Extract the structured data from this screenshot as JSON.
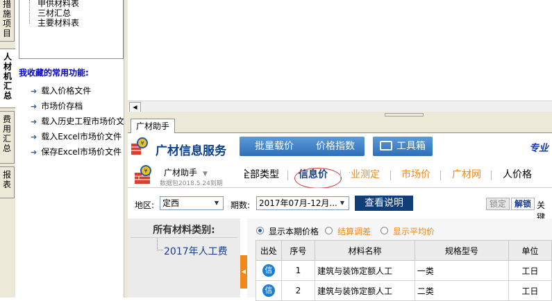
{
  "side_tabs": [
    "措施项目",
    "人材机汇总",
    "费用汇总",
    "报表"
  ],
  "tree": {
    "items": [
      "甲供材料表",
      "三材汇总",
      "主要材料表"
    ]
  },
  "favorites": {
    "title": "我收藏的常用功能:",
    "items": [
      "载入价格文件",
      "市场价存档",
      "载入历史工程市场价文",
      "载入Excel市场价文件",
      "保存Excel市场价文件"
    ]
  },
  "assistant_tab": "广材助手",
  "brand": {
    "title": "广材信息服务",
    "buttons": [
      "批量载价",
      "价格指数",
      "工具箱"
    ],
    "right_text": "专业"
  },
  "helper": {
    "title": "广材助手",
    "subtitle": "数据包2018.5.24到期"
  },
  "nav_tabs": [
    "全部类型",
    "信息价",
    "专业测定",
    "市场价",
    "广材网",
    "人价格"
  ],
  "filters": {
    "region_label": "地区:",
    "region_value": "定西",
    "period_label": "期数:",
    "period_value": "2017年07月-12月...",
    "help_button": "查看说明",
    "lock_button": "锁定",
    "unlock_button": "解锁",
    "right_text": "关键"
  },
  "categories": {
    "title": "所有材料类别:",
    "items": [
      "2017年人工费"
    ]
  },
  "options": {
    "selected": "显示本期价格",
    "items": [
      "显示本期价格",
      "结算调差",
      "显示平均价"
    ]
  },
  "table": {
    "headers": [
      "出处",
      "序号",
      "材料名称",
      "规格型号",
      "单位"
    ],
    "rows": [
      {
        "source": "信",
        "index": "1",
        "name": "建筑与装饰定额人工",
        "spec": "一类",
        "unit": "工日"
      },
      {
        "source": "信",
        "index": "2",
        "name": "建筑与装饰定额人工",
        "spec": "二类",
        "unit": "工日"
      }
    ]
  },
  "colors": {
    "brand_blue": "#2f6fb8",
    "accent_orange": "#f0891c",
    "badge_blue": "#1a7fd4",
    "circle_red": "#d43a3a"
  }
}
